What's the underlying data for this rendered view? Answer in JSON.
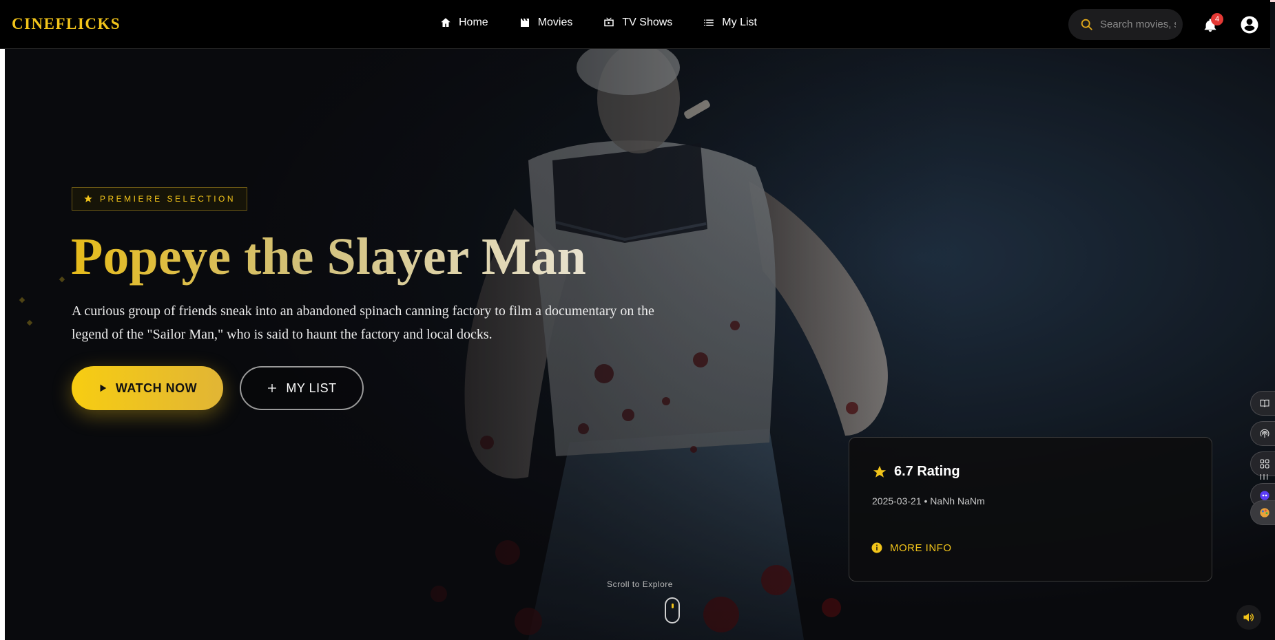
{
  "navbar": {
    "logo": "CINEFLICKS",
    "links": [
      {
        "label": "Home",
        "icon": "home-icon"
      },
      {
        "label": "Movies",
        "icon": "clapperboard-icon"
      },
      {
        "label": "TV Shows",
        "icon": "tv-icon"
      },
      {
        "label": "My List",
        "icon": "list-icon"
      }
    ],
    "search_placeholder": "Search movies, s",
    "notification_count": "4"
  },
  "hero": {
    "badge": "PREMIERE SELECTION",
    "title": "Popeye the Slayer Man",
    "description": "A curious group of friends sneak into an abandoned spinach canning factory to film a documentary on the legend of the \"Sailor Man,\" who is said to haunt the factory and local docks.",
    "watch_label": "WATCH NOW",
    "list_label": "MY LIST"
  },
  "info_card": {
    "rating": "6.7 Rating",
    "meta": "2025-03-21 • NaNh NaNm",
    "more_info": "MORE INFO"
  },
  "scroll_hint": "Scroll to Explore",
  "colors": {
    "accent": "#f2c41a",
    "background": "#0b0c10",
    "badge": "#e53935"
  },
  "side_dock": [
    "book-icon",
    "podcast-icon",
    "grid-icon",
    "bars-icon",
    "bot-icon",
    "palette-icon"
  ]
}
